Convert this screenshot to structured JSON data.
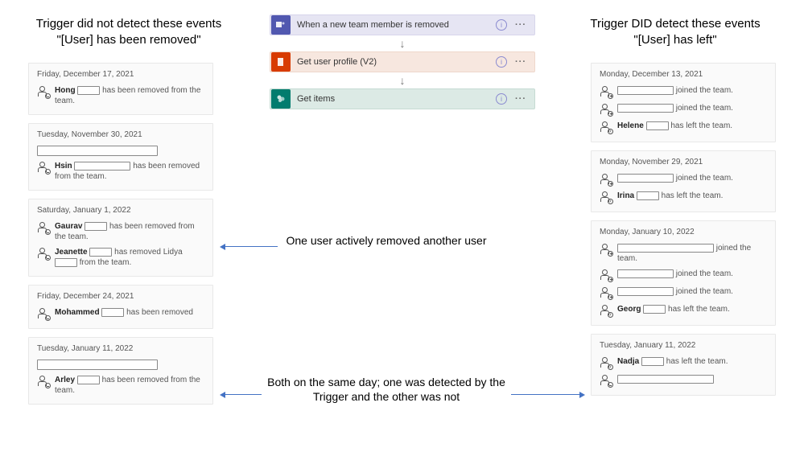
{
  "headings": {
    "left_line1": "Trigger did not detect these events",
    "left_line2": "\"[User] has been removed\"",
    "right_line1": "Trigger DID detect these events",
    "right_line2": "\"[User] has left\""
  },
  "flow": {
    "steps": [
      {
        "label": "When a new team member is removed",
        "icon": "teams"
      },
      {
        "label": "Get user profile (V2)",
        "icon": "office"
      },
      {
        "label": "Get items",
        "icon": "sharepoint"
      }
    ]
  },
  "annotations": {
    "a1": "One user actively removed another user",
    "a2": "Both on the same day; one was detected by the Trigger and the other was not"
  },
  "left_cards": [
    {
      "date": "Friday, December 17, 2021",
      "events": [
        {
          "icon": "remove",
          "bold": "Hong",
          "redact": "sm",
          "tail": "has been removed from the team."
        }
      ]
    },
    {
      "date": "Tuesday, November 30, 2021",
      "pre_redact": true,
      "events": [
        {
          "icon": "remove",
          "bold": "Hsin",
          "redact": "md",
          "tail": "has been removed from the team."
        }
      ]
    },
    {
      "date": "Saturday, January 1, 2022",
      "events": [
        {
          "icon": "remove",
          "bold": "Gaurav",
          "redact": "sm",
          "tail": "has been removed from the team."
        },
        {
          "icon": "remove",
          "bold": "Jeanette",
          "redact": "sm",
          "tail_prefix": "has removed Lidya",
          "redact2": "sm",
          "tail": "from the team."
        }
      ]
    },
    {
      "date": "Friday, December 24, 2021",
      "events": [
        {
          "icon": "remove",
          "bold": "Mohammed",
          "redact": "sm",
          "tail": "has been removed"
        }
      ]
    },
    {
      "date": "Tuesday, January 11, 2022",
      "pre_redact": true,
      "events": [
        {
          "icon": "remove",
          "bold": "Arley",
          "redact": "sm",
          "tail": "has been removed from the team."
        }
      ]
    }
  ],
  "right_cards": [
    {
      "date": "Monday, December 13, 2021",
      "events": [
        {
          "icon": "add",
          "redact_only": "md",
          "tail": "joined the team."
        },
        {
          "icon": "add",
          "redact_only": "md",
          "tail": "joined the team."
        },
        {
          "icon": "left",
          "bold": "Helene",
          "redact": "sm",
          "tail": "has left the team."
        }
      ]
    },
    {
      "date": "Monday, November 29, 2021",
      "events": [
        {
          "icon": "add",
          "redact_only": "md",
          "tail": "joined the team."
        },
        {
          "icon": "left",
          "bold": "Irina",
          "redact": "sm",
          "tail": "has left the team."
        }
      ]
    },
    {
      "date": "Monday, January 10, 2022",
      "events": [
        {
          "icon": "add",
          "redact_only": "lg",
          "tail": "joined the team."
        },
        {
          "icon": "add",
          "redact_only": "md",
          "tail": "joined the team."
        },
        {
          "icon": "add",
          "redact_only": "md",
          "tail": "joined the team."
        },
        {
          "icon": "left",
          "bold": "Georg",
          "redact": "sm",
          "tail": "has left the team."
        }
      ]
    },
    {
      "date": "Tuesday, January 11, 2022",
      "events": [
        {
          "icon": "left",
          "bold": "Nadja",
          "redact": "sm",
          "tail": "has left the team."
        },
        {
          "icon": "remove",
          "redact_only": "lg",
          "tail": ""
        }
      ]
    }
  ]
}
